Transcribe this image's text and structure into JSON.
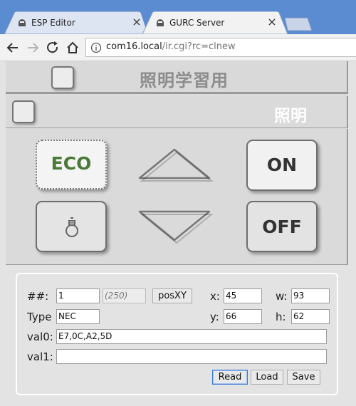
{
  "browser": {
    "tabs": [
      {
        "title": "ESP Editor",
        "close": "×"
      },
      {
        "title": "GURC Server",
        "close": "×"
      }
    ],
    "url_host": "com16.local",
    "url_path": "/ir.cgi?rc=clnew"
  },
  "panel": {
    "title1": "照明学習用",
    "title2": "照明",
    "buttons": {
      "eco": "ECO",
      "on": "ON",
      "off": "OFF"
    }
  },
  "form": {
    "labels": {
      "num": "##:",
      "type": "Type",
      "val0": "val0:",
      "val1": "val1:",
      "x": "x:",
      "y": "y:",
      "w": "w:",
      "h": "h:"
    },
    "values": {
      "num": "1",
      "num_max": "(250)",
      "type": "NEC",
      "val0": "E7,0C,A2,5D",
      "val1": "",
      "x": "45",
      "y": "66",
      "w": "93",
      "h": "62"
    },
    "buttons": {
      "posxy": "posXY",
      "read": "Read",
      "load": "Load",
      "save": "Save"
    }
  }
}
